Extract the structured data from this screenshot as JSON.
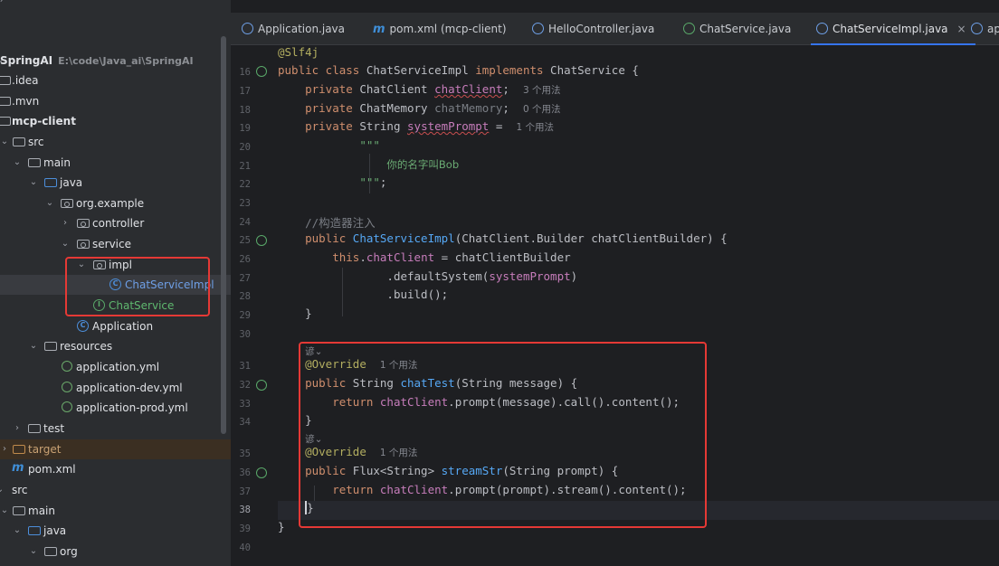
{
  "project_tree": {
    "rows": [
      {
        "label": "SpringAI",
        "sub": "E:\\code\\Java_ai\\SpringAI",
        "icon": "folder",
        "bold": true
      },
      {
        "label": ".idea",
        "icon": "folder"
      },
      {
        "label": ".mvn",
        "icon": "folder"
      },
      {
        "label": "mcp-client",
        "icon": "folder",
        "bold": true
      },
      {
        "label": "src",
        "icon": "folder"
      },
      {
        "label": "main",
        "icon": "folder"
      },
      {
        "label": "java",
        "icon": "folder"
      },
      {
        "label": "org.example",
        "icon": "package"
      },
      {
        "label": "controller",
        "icon": "package"
      },
      {
        "label": "service",
        "icon": "package"
      },
      {
        "label": "impl",
        "icon": "package"
      },
      {
        "label": "ChatServiceImpl",
        "icon": "class"
      },
      {
        "label": "ChatService",
        "icon": "interface"
      },
      {
        "label": "Application",
        "icon": "class"
      },
      {
        "label": "resources",
        "icon": "folder"
      },
      {
        "label": "application.yml",
        "icon": "yml"
      },
      {
        "label": "application-dev.yml",
        "icon": "yml"
      },
      {
        "label": "application-prod.yml",
        "icon": "yml"
      },
      {
        "label": "test",
        "icon": "folder"
      },
      {
        "label": "target",
        "icon": "folder-excluded"
      },
      {
        "label": "pom.xml",
        "icon": "maven"
      },
      {
        "label": "src",
        "icon": "folder"
      },
      {
        "label": "main",
        "icon": "folder"
      },
      {
        "label": "java",
        "icon": "folder"
      },
      {
        "label": "org",
        "icon": "folder"
      }
    ]
  },
  "tabs": [
    {
      "label": "Application.java",
      "icon": "class-icon"
    },
    {
      "label": "pom.xml (mcp-client)",
      "icon": "maven-icon"
    },
    {
      "label": "HelloController.java",
      "icon": "class-icon"
    },
    {
      "label": "ChatService.java",
      "icon": "interface-icon"
    },
    {
      "label": "ChatServiceImpl.java",
      "icon": "class-icon",
      "active": true,
      "close": "×"
    },
    {
      "label": "ap",
      "icon": "class-icon"
    }
  ],
  "editor": {
    "line_numbers": [
      "",
      "16",
      "17",
      "18",
      "19",
      "20",
      "21",
      "22",
      "23",
      "24",
      "25",
      "26",
      "27",
      "28",
      "29",
      "30",
      "",
      "31",
      "32",
      "33",
      "34",
      "",
      "35",
      "36",
      "37",
      "38",
      "39",
      "40"
    ],
    "current_line": "38",
    "code": {
      "slf4j": "@Slf4j",
      "class_decl_1": "public class ",
      "class_name": "ChatServiceImpl",
      "class_decl_2": " implements ChatService {",
      "f1_kw": "private",
      "f1_type": " ChatClient ",
      "f1_name": "chatClient",
      "f1_end": ";",
      "f1_hint": "3 个用法",
      "f2_kw": "private",
      "f2_type": " ChatMemory ",
      "f2_name": "chatMemory",
      "f2_end": ";",
      "f2_hint": "0 个用法",
      "f3_kw": "private",
      "f3_type": " String ",
      "f3_name": "systemPrompt",
      "f3_end": " =",
      "f3_hint": "1 个用法",
      "tb_open": "\"\"\"",
      "tb_text": "你的名字叫Bob",
      "tb_close": "\"\"\"",
      "tb_end": ";",
      "comment": "//构造器注入",
      "ctor_kw": "public ",
      "ctor_name": "ChatServiceImpl",
      "ctor_params": "(ChatClient.Builder chatClientBuilder) {",
      "this_kw": "this",
      "this_dot": ".",
      "this_field": "chatClient",
      "this_rest": " = chatClientBuilder",
      "default_1": ".defaultSystem(",
      "default_arg": "systemPrompt",
      "default_2": ")",
      "build": ".build();",
      "ctor_close": "}",
      "author1": "谚",
      "override1": "@Override",
      "override1_hint": "1 个用法",
      "m1_kw": "public",
      "m1_type": " String ",
      "m1_name": "chatTest",
      "m1_params": "(String message) {",
      "m1_ret": "return ",
      "m1_field": "chatClient",
      "m1_rest": ".prompt(message).call().content();",
      "m1_close": "}",
      "author2": "谚",
      "override2": "@Override",
      "override2_hint": "1 个用法",
      "m2_kw": "public",
      "m2_type": " Flux<String> ",
      "m2_name": "streamStr",
      "m2_params": "(String prompt) {",
      "m2_ret": "return ",
      "m2_field": "chatClient",
      "m2_rest": ".prompt(prompt).stream().content();",
      "m2_close": "}",
      "class_close": "}"
    }
  },
  "colors": {
    "highlight_box": "#e53935",
    "active_tab_underline": "#3574f0"
  }
}
